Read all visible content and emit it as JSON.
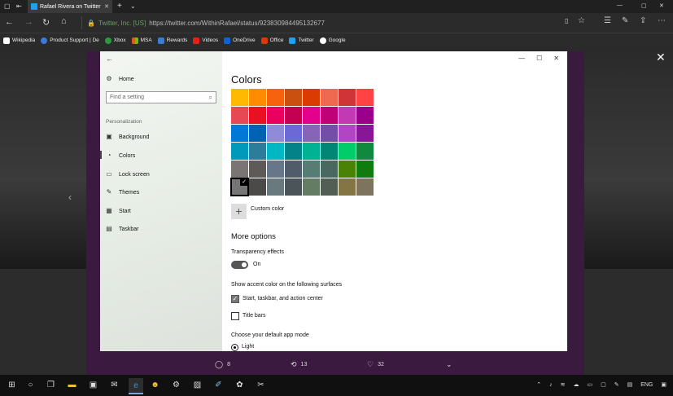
{
  "browser": {
    "tab_title": "Rafael Rivera on Twitter",
    "url_host": "Twitter, Inc. [US]",
    "url_path": "https://twitter.com/WithinRafael/status/923830984495132677",
    "favorites": [
      {
        "label": "Wikipedia",
        "icon": "wikipedia-icon",
        "color": "#ffffff"
      },
      {
        "label": "Product Support | De",
        "icon": "globe-icon",
        "color": "#3a7bd5"
      },
      {
        "label": "Xbox",
        "icon": "xbox-icon",
        "color": "#2b9a3a"
      },
      {
        "label": "MSA",
        "icon": "microsoft-icon",
        "color": "#f25022"
      },
      {
        "label": "Rewards",
        "icon": "rewards-icon",
        "color": "#3a7bd5"
      },
      {
        "label": "Videos",
        "icon": "youtube-icon",
        "color": "#e62117"
      },
      {
        "label": "OneDrive",
        "icon": "onedrive-icon",
        "color": "#0a64d8"
      },
      {
        "label": "Office",
        "icon": "office-icon",
        "color": "#d83b01"
      },
      {
        "label": "Twitter",
        "icon": "twitter-icon",
        "color": "#1da1f2"
      },
      {
        "label": "Google",
        "icon": "google-icon",
        "color": "#ffffff"
      }
    ]
  },
  "settings": {
    "nav": {
      "home": "Home",
      "search_placeholder": "Find a setting",
      "section": "Personalization",
      "items": [
        {
          "label": "Background",
          "icon": "picture-icon"
        },
        {
          "label": "Colors",
          "icon": "palette-icon",
          "selected": true
        },
        {
          "label": "Lock screen",
          "icon": "lock-screen-icon"
        },
        {
          "label": "Themes",
          "icon": "themes-icon"
        },
        {
          "label": "Start",
          "icon": "start-icon"
        },
        {
          "label": "Taskbar",
          "icon": "taskbar-icon"
        }
      ]
    },
    "title": "Colors",
    "swatches": [
      "#FFB900",
      "#FF8C00",
      "#F7630C",
      "#CA5010",
      "#DA3B01",
      "#EF6950",
      "#D13438",
      "#FF4343",
      "#E74856",
      "#E81123",
      "#EA005E",
      "#C30052",
      "#E3008C",
      "#BF0077",
      "#C239B3",
      "#9A0089",
      "#0078D7",
      "#0063B1",
      "#8E8CD8",
      "#6B69D6",
      "#8764B8",
      "#744DA9",
      "#B146C2",
      "#881798",
      "#0099BC",
      "#2D7D9A",
      "#00B7C3",
      "#038387",
      "#00B294",
      "#018574",
      "#00CC6A",
      "#10893E",
      "#7A7574",
      "#5D5A58",
      "#68768A",
      "#515C6B",
      "#567C73",
      "#486860",
      "#498205",
      "#107C10",
      "#767676",
      "#4C4A48",
      "#69797E",
      "#4A5459",
      "#647C64",
      "#525E54",
      "#847545",
      "#7E735F"
    ],
    "selected_swatch": 40,
    "custom_color": "Custom color",
    "more_options": "More options",
    "transparency_label": "Transparency effects",
    "transparency_state": "On",
    "accent_surfaces_label": "Show accent color on the following surfaces",
    "surface_start": "Start, taskbar, and action center",
    "surface_title": "Title bars",
    "app_mode_label": "Choose your default app mode",
    "app_mode_light": "Light"
  },
  "tweet_actions": {
    "replies": "8",
    "retweets": "13",
    "likes": "32"
  },
  "taskbar": {
    "lang": "ENG"
  }
}
